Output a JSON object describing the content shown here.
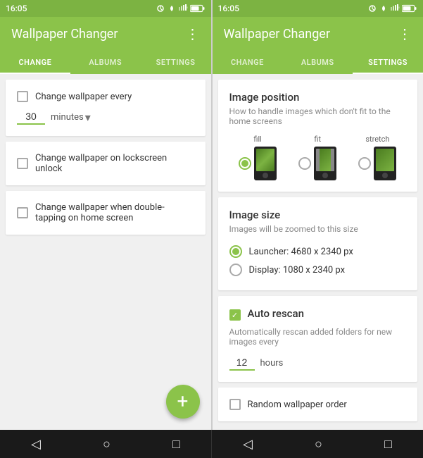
{
  "left_phone": {
    "status_time": "16:05",
    "status_icons": "⏰ ▲▲ 61%",
    "app_title": "Wallpaper Changer",
    "menu_icon": "⋮",
    "tabs": [
      {
        "label": "CHANGE",
        "active": true
      },
      {
        "label": "ALBUMS",
        "active": false
      },
      {
        "label": "SETTINGS",
        "active": false
      }
    ],
    "card1": {
      "checkbox_label": "Change wallpaper every",
      "checked": false,
      "minutes_value": "30",
      "dropdown_label": "minutes"
    },
    "card2": {
      "checkbox_label": "Change wallpaper on lockscreen unlock",
      "checked": false
    },
    "card3": {
      "checkbox_label": "Change wallpaper when double-tapping on home screen",
      "checked": false
    },
    "fab_label": "+"
  },
  "right_phone": {
    "status_time": "16:05",
    "status_icons": "⏰ ▲▲ 61%",
    "app_title": "Wallpaper Changer",
    "menu_icon": "⋮",
    "tabs": [
      {
        "label": "CHANGE",
        "active": false
      },
      {
        "label": "ALBUMS",
        "active": false
      },
      {
        "label": "SETTINGS",
        "active": true
      }
    ],
    "image_position": {
      "title": "Image position",
      "desc": "How to handle images which don't fit to the home screens",
      "options": [
        {
          "label": "fill",
          "selected": true,
          "style": "fill"
        },
        {
          "label": "fit",
          "selected": false,
          "style": "fit"
        },
        {
          "label": "stretch",
          "selected": false,
          "style": "stretch"
        }
      ]
    },
    "image_size": {
      "title": "Image size",
      "desc": "Images will be zoomed to this size",
      "options": [
        {
          "label": "Launcher: 4680 x 2340 px",
          "selected": true
        },
        {
          "label": "Display: 1080 x 2340 px",
          "selected": false
        }
      ]
    },
    "auto_rescan": {
      "title": "Auto rescan",
      "desc": "Automatically rescan added folders for new images every",
      "checked": true,
      "hours_value": "12",
      "hours_label": "hours"
    },
    "random_wallpaper": {
      "checkbox_label": "Random wallpaper order",
      "checked": false
    }
  },
  "nav": {
    "back_icon": "◁",
    "home_icon": "○",
    "recent_icon": "□"
  }
}
